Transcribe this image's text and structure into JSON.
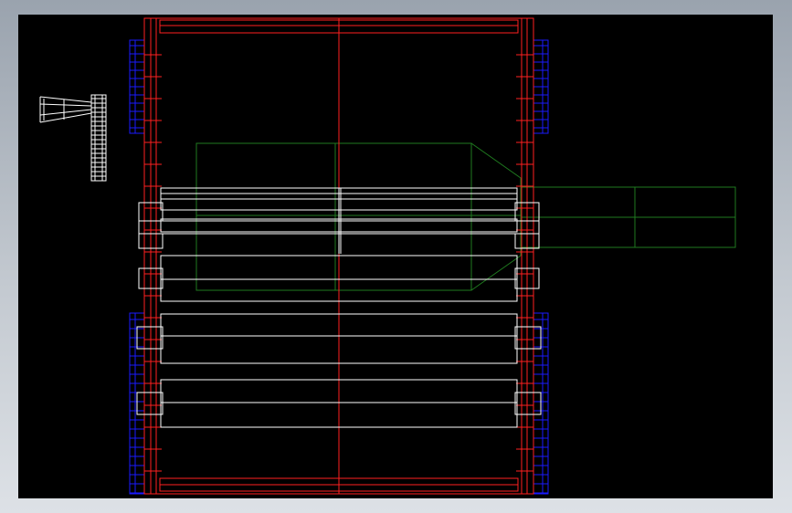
{
  "app": {
    "view": "cad-model-space"
  },
  "colors": {
    "frame": "#ff2020",
    "blue_parts": "#1a1aff",
    "rollers": "#ffffff",
    "motor": "#1f7a1f",
    "background": "#000000",
    "window": "#b8bec6"
  },
  "icons": {
    "detail_view": "small-side-view-drawing"
  }
}
